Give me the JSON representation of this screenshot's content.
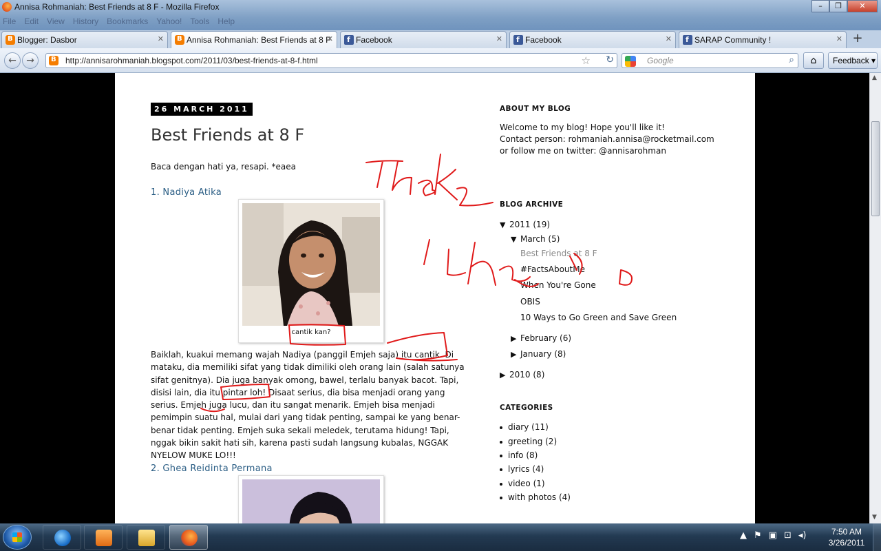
{
  "window": {
    "title": "Annisa Rohmaniah: Best Friends at 8 F - Mozilla Firefox",
    "menu": [
      "File",
      "Edit",
      "View",
      "History",
      "Bookmarks",
      "Yahoo!",
      "Tools",
      "Help"
    ],
    "controls": {
      "minimize": "–",
      "maximize": "❐",
      "close": "✕"
    }
  },
  "tabs": [
    {
      "label": "Blogger: Dasbor",
      "icon": "blogger-icon",
      "close": "✕"
    },
    {
      "label": "Annisa Rohmaniah: Best Friends at 8 F",
      "icon": "blogger-icon",
      "close": "✕",
      "active": true
    },
    {
      "label": "Facebook",
      "icon": "facebook-icon",
      "close": "✕"
    },
    {
      "label": "Facebook",
      "icon": "facebook-icon",
      "close": "✕"
    },
    {
      "label": "SARAP Community !",
      "icon": "facebook-icon",
      "close": "✕"
    }
  ],
  "newtab": "+",
  "nav": {
    "back": "←",
    "forward": "→",
    "url": "http://annisarohmaniah.blogspot.com/2011/03/best-friends-at-8-f.html",
    "bookmark": "☆",
    "reload": "↻",
    "search_placeholder": "Google",
    "search_button": "⌕",
    "home": "⌂",
    "feedback": "Feedback ▾"
  },
  "post": {
    "date": "26 MARCH 2011",
    "title": "Best Friends at 8 F",
    "intro": "Baca dengan hati ya, resapi. *eaea",
    "friends": [
      {
        "heading": "1. Nadiya Atika",
        "caption": "cantik kan?",
        "paragraph": "Baiklah, kuakui memang wajah Nadiya (panggil Emjeh saja) itu cantik. Di mataku, dia memiliki sifat yang tidak dimiliki oleh orang lain (salah satunya sifat genitnya). Dia juga banyak omong, bawel, terlalu banyak bacot. Tapi, disisi lain, dia itu pintar loh! Disaat serius, dia bisa menjadi orang yang serius. Emjeh juga lucu, dan itu sangat menarik. Emjeh bisa menjadi pemimpin suatu hal, mulai dari yang tidak penting, sampai ke yang benar-benar tidak penting. Emjeh suka sekali meledek, terutama hidung! Tapi, nggak bikin sakit hati sih, karena pasti sudah langsung kubalas, NGGAK NYELOW MUKE LO!!!"
      },
      {
        "heading": "2. Ghea Reidinta Permana"
      }
    ]
  },
  "sidebar": {
    "about": {
      "heading": "ABOUT MY BLOG",
      "line1": "Welcome to my blog! Hope you'll like it!",
      "line2": "Contact person: rohmaniah.annisa@rocketmail.com",
      "line3": "or follow me on twitter: @annisarohman"
    },
    "archive": {
      "heading": "BLOG ARCHIVE",
      "year2011": "2011",
      "year2011_count": "(19)",
      "march": "March",
      "march_count": "(5)",
      "posts": [
        "Best Friends at 8 F",
        "#FactsAboutMe",
        "When You're Gone",
        "OBIS",
        "10 Ways to Go Green and Save Green"
      ],
      "february": "February",
      "february_count": "(6)",
      "january": "January",
      "january_count": "(8)",
      "year2010": "2010",
      "year2010_count": "(8)",
      "open": "▼",
      "closed": "▶"
    },
    "categories": {
      "heading": "CATEGORIES",
      "items": [
        "diary (11)",
        "greeting (2)",
        "info (8)",
        "lyrics (4)",
        "video (1)",
        "with photos (4)"
      ]
    }
  },
  "taskbar": {
    "time": "7:50 AM",
    "date": "3/26/2011",
    "apps": [
      "internet-explorer-icon",
      "media-player-icon",
      "explorer-icon",
      "firefox-icon"
    ]
  }
}
